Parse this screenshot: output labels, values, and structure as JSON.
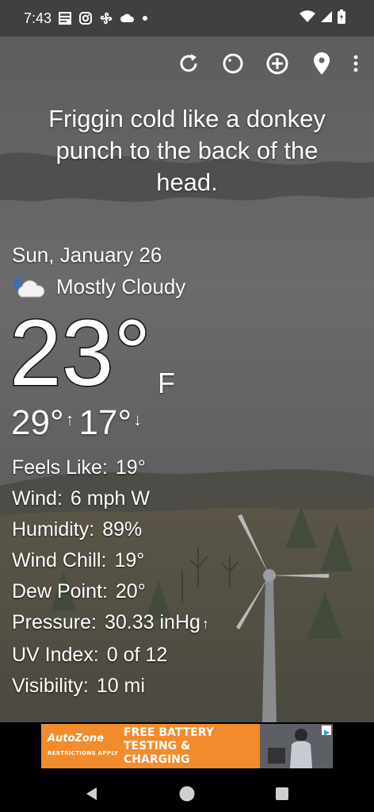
{
  "status_bar": {
    "time": "7:43",
    "icons": [
      "weather-channel-icon",
      "instagram-icon",
      "fan-icon",
      "cloud-icon",
      "dot-icon",
      "wifi-icon",
      "signal-icon",
      "battery-icon"
    ]
  },
  "toolbar": {
    "actions": [
      "refresh-icon",
      "theme-icon",
      "add-location-icon",
      "location-pin-icon",
      "more-options-icon"
    ]
  },
  "headline": "Friggin cold like a donkey punch to the back of the head.",
  "current": {
    "date": "Sun, January 26",
    "condition": "Mostly Cloudy",
    "condition_icon": "partly-cloudy-night-icon",
    "temperature": "23°",
    "unit": "F",
    "high": "29°",
    "low": "17°"
  },
  "details": [
    {
      "label": "Feels Like:",
      "value": "19°"
    },
    {
      "label": "Wind:",
      "value": "6 mph W"
    },
    {
      "label": "Humidity:",
      "value": "89%"
    },
    {
      "label": "Wind Chill:",
      "value": "19°"
    },
    {
      "label": "Dew Point:",
      "value": "20°"
    },
    {
      "label": "Pressure:",
      "value": "30.33 inHg",
      "trend": "↑"
    },
    {
      "label": "UV Index:",
      "value": "0 of 12"
    },
    {
      "label": "Visibility:",
      "value": "10 mi"
    }
  ],
  "ad": {
    "brand": "AutoZone",
    "brand_sub": "RESTRICTIONS APPLY",
    "headline_1": "FREE BATTERY",
    "headline_2": "TESTING & CHARGING"
  },
  "colors": {
    "ad_orange": "#f28b2c",
    "sky": "#6e6e6e",
    "text": "#ffffff"
  }
}
